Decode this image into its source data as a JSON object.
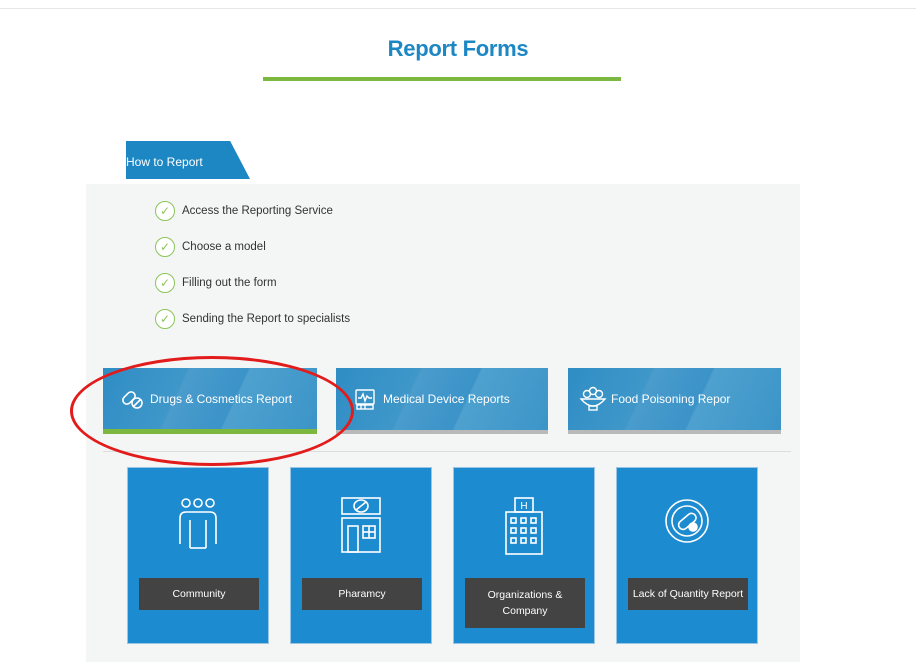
{
  "page": {
    "title": "Report Forms"
  },
  "how_to": {
    "tab_label": "How to Report",
    "steps": [
      "Access the Reporting Service",
      "Choose a model",
      "Filling out the form",
      "Sending the Report to specialists"
    ],
    "check_icon": "check-circle-icon"
  },
  "categories": [
    {
      "label": "Drugs & Cosmetics Report",
      "icon": "pills-icon",
      "active": true
    },
    {
      "label": "Medical Device Reports",
      "icon": "medical-monitor-icon",
      "active": false
    },
    {
      "label": "Food Poisoning Repor",
      "icon": "food-bowl-icon",
      "active": false
    }
  ],
  "report_cards": [
    {
      "label": "Community",
      "icon": "people-group-icon"
    },
    {
      "label": "Pharamcy",
      "icon": "pharmacy-icon"
    },
    {
      "label": "Organizations & Company",
      "icon": "hospital-building-icon"
    },
    {
      "label": "Lack of Quantity Report",
      "icon": "pill-bottle-icon"
    }
  ],
  "colors": {
    "primary_blue": "#1d87c4",
    "accent_green": "#7cb73f",
    "label_gray": "#434343",
    "annotation_red": "#e21b1b"
  }
}
